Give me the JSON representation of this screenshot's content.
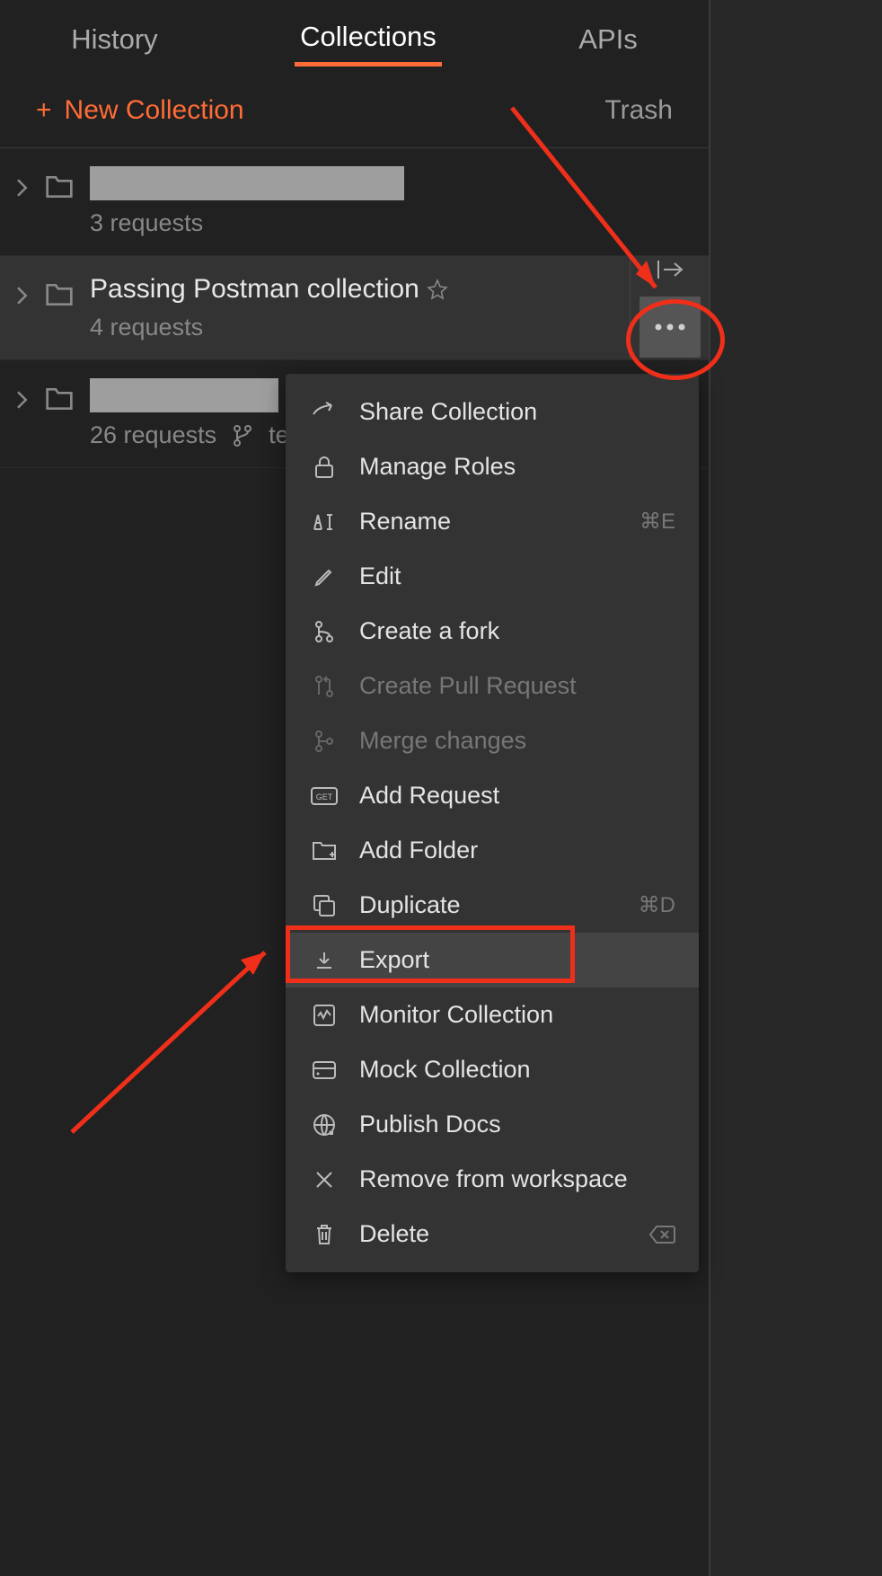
{
  "tabs": {
    "history": "History",
    "collections": "Collections",
    "apis": "APIs"
  },
  "actions": {
    "new_collection": "New Collection",
    "trash": "Trash"
  },
  "collections": [
    {
      "requests": "3 requests"
    },
    {
      "name": "Passing Postman collection",
      "requests": "4 requests"
    },
    {
      "requests": "26 requests",
      "branch": "tes"
    }
  ],
  "menu": {
    "share": "Share Collection",
    "roles": "Manage Roles",
    "rename": "Rename",
    "rename_shortcut": "⌘E",
    "edit": "Edit",
    "fork": "Create a fork",
    "pull": "Create Pull Request",
    "merge": "Merge changes",
    "add_request": "Add Request",
    "add_folder": "Add Folder",
    "duplicate": "Duplicate",
    "duplicate_shortcut": "⌘D",
    "export": "Export",
    "monitor": "Monitor Collection",
    "mock": "Mock Collection",
    "publish": "Publish Docs",
    "remove": "Remove from workspace",
    "delete": "Delete"
  }
}
